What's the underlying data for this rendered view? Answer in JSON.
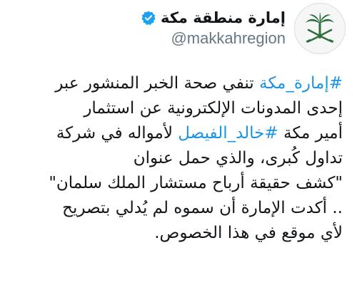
{
  "tweet": {
    "author": {
      "display_name": "إمارة منطقة مكة",
      "handle": "@makkahregion",
      "verified": true,
      "avatar_icon": "saudi-emblem-palm-swords-icon"
    },
    "text_lines": [
      {
        "hashtag": "#إمارة_مكة",
        "text": " تنفي صحة الخبر المنشور عبر"
      },
      {
        "text": "إحدى المدونات الإلكترونية عن استثمار"
      },
      {
        "text_before": "أمير مكة ",
        "hashtag": "#خالد_الفيصل",
        "text": " لأمواله في شركة"
      },
      {
        "text": "تداول كُبرى، والذي حمل عنوان"
      },
      {
        "text": "\"كشف حقيقة أرباح مستشار الملك سلمان\""
      },
      {
        "text": ".. أكدت الإمارة أن سموه لم يُدلي بتصريح"
      },
      {
        "text": "لأي موقع في هذا الخصوص."
      }
    ]
  },
  "colors": {
    "hashtag": "#1b95e0",
    "verified_badge": "#1da1f2",
    "emblem": "#2f6f3e",
    "text": "#14171a",
    "handle": "#657786"
  }
}
